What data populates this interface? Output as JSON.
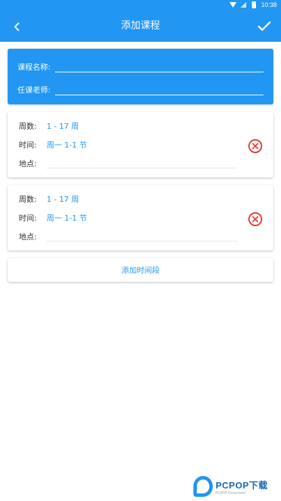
{
  "status_bar": {
    "time": "10:38",
    "icons": [
      "wifi-icon",
      "signal-icon",
      "battery-icon"
    ]
  },
  "header": {
    "title": "添加课程",
    "back_icon": "chevron-left-icon",
    "confirm_icon": "check-icon"
  },
  "course_info": {
    "name_label": "课程名称:",
    "name_value": "",
    "teacher_label": "任课老师:",
    "teacher_value": ""
  },
  "time_slots": [
    {
      "weeks_label": "周数:",
      "weeks_value": "1 - 17 周",
      "time_label": "时间:",
      "time_value": "周一 1-1 节",
      "place_label": "地点:",
      "place_value": ""
    },
    {
      "weeks_label": "周数:",
      "weeks_value": "1 - 17 周",
      "time_label": "时间:",
      "time_value": "周一 1-1 节",
      "place_label": "地点:",
      "place_value": ""
    }
  ],
  "add_button_label": "添加时间段",
  "watermark": {
    "brand": "PCPOP下载",
    "sub": "PCPOP Download"
  },
  "colors": {
    "primary": "#2196f3",
    "delete": "#e53935"
  }
}
